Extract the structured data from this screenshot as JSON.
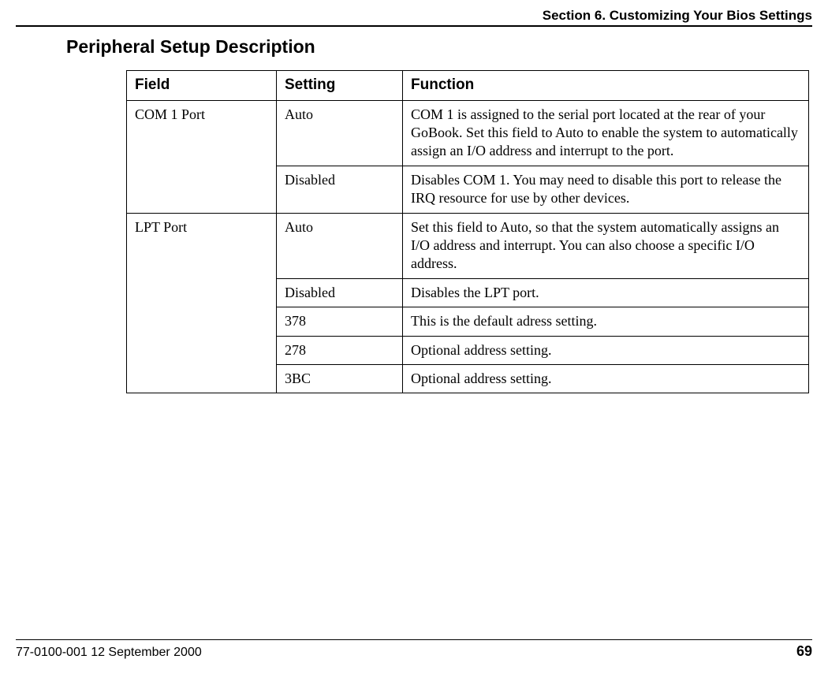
{
  "header": {
    "section_title": "Section 6. Customizing Your Bios Settings"
  },
  "title": "Peripheral Setup Description",
  "table": {
    "headers": {
      "field": "Field",
      "setting": "Setting",
      "function": "Function"
    },
    "groups": [
      {
        "field": "COM 1 Port",
        "rows": [
          {
            "setting": "Auto",
            "function": "COM 1 is assigned to the serial port located at the rear of your GoBook. Set this field to Auto to enable the system to automatically assign an I/O address and interrupt to the port."
          },
          {
            "setting": "Disabled",
            "function": "Disables COM 1. You may need to disable this port to release the IRQ resource for use by other devices."
          }
        ]
      },
      {
        "field": "LPT Port",
        "rows": [
          {
            "setting": "Auto",
            "function": "Set this field to Auto, so that the system automatically assigns an I/O address and interrupt. You can also choose a specific I/O address."
          },
          {
            "setting": "Disabled",
            "function": "Disables the LPT port."
          },
          {
            "setting": "378",
            "function": "This is the default adress setting."
          },
          {
            "setting": "278",
            "function": "Optional address setting."
          },
          {
            "setting": "3BC",
            "function": "Optional address setting."
          }
        ]
      }
    ]
  },
  "footer": {
    "doc_id": "77-0100-001   12 September 2000",
    "page_number": "69"
  }
}
